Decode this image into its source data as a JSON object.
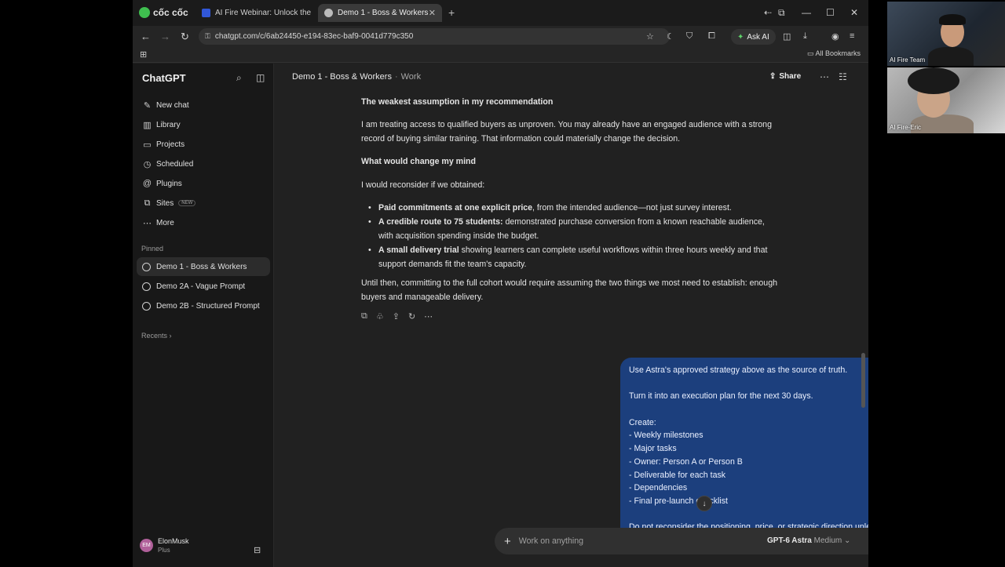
{
  "browser": {
    "brand": "cốc cốc",
    "tabs": [
      {
        "title": "AI Fire Webinar: Unlock the full",
        "active": false
      },
      {
        "title": "Demo 1 - Boss & Workers",
        "active": true
      }
    ],
    "url": "chatgpt.com/c/6ab24450-e194-83ec-baf9-0041d779c350",
    "ask_ai_label": "Ask AI",
    "all_bookmarks_label": "All Bookmarks"
  },
  "sidebar": {
    "logo": "ChatGPT",
    "nav": [
      {
        "label": "New chat",
        "icon": "edit-icon"
      },
      {
        "label": "Library",
        "icon": "library-icon"
      },
      {
        "label": "Projects",
        "icon": "folder-icon"
      },
      {
        "label": "Scheduled",
        "icon": "clock-icon"
      },
      {
        "label": "Plugins",
        "icon": "plugin-icon"
      },
      {
        "label": "Sites",
        "icon": "sites-icon",
        "badge": "NEW"
      },
      {
        "label": "More",
        "icon": "more-icon"
      }
    ],
    "pinned_label": "Pinned",
    "pinned": [
      {
        "label": "Demo 1 - Boss & Workers",
        "active": true
      },
      {
        "label": "Demo 2A - Vague Prompt",
        "active": false
      },
      {
        "label": "Demo 2B - Structured Prompt",
        "active": false
      }
    ],
    "recents_label": "Recents",
    "user": {
      "initials": "EM",
      "name": "ElonMusk",
      "plan": "Plus"
    }
  },
  "header": {
    "title": "Demo 1 - Boss & Workers",
    "separator": "·",
    "project": "Work",
    "share_label": "Share"
  },
  "assistant": {
    "heading1": "The weakest assumption in my recommendation",
    "para1": "I am treating access to qualified buyers as unproven. You may already have an engaged audience with a strong record of buying similar training. That information could materially change the decision.",
    "heading2": "What would change my mind",
    "para2": "I would reconsider if we obtained:",
    "bullets": [
      {
        "bold": "Paid commitments at one explicit price",
        "text": ", from the intended audience—not just survey interest."
      },
      {
        "bold": "A credible route to 75 students:",
        "text": " demonstrated purchase conversion from a known reachable audience, with acquisition spending inside the budget."
      },
      {
        "bold": "A small delivery trial",
        "text": " showing learners can complete useful workflows within three hours weekly and that support demands fit the team's capacity."
      }
    ],
    "para3": "Until then, committing to the full cohort would require assuming the two things we most need to establish: enough buyers and manageable delivery."
  },
  "user_message": {
    "lines": [
      "Use Astra's approved strategy above as the source of truth.",
      "",
      "Turn it into an execution plan for the next 30 days.",
      "",
      "Create:",
      "- Weekly milestones",
      "- Major tasks",
      "- Owner: Person A or Person B",
      "- Deliverable for each task",
      "- Dependencies",
      "- Final pre-launch checklist",
      "",
      "Do not reconsider the positioning, price, or strategic direction unless"
    ]
  },
  "composer": {
    "placeholder": "Work on anything",
    "model_name": "GPT-6 Astra",
    "model_level": "Medium"
  },
  "video": {
    "tile1_label": "AI Fire Team",
    "tile2_label": "AI Fire-Eric"
  }
}
